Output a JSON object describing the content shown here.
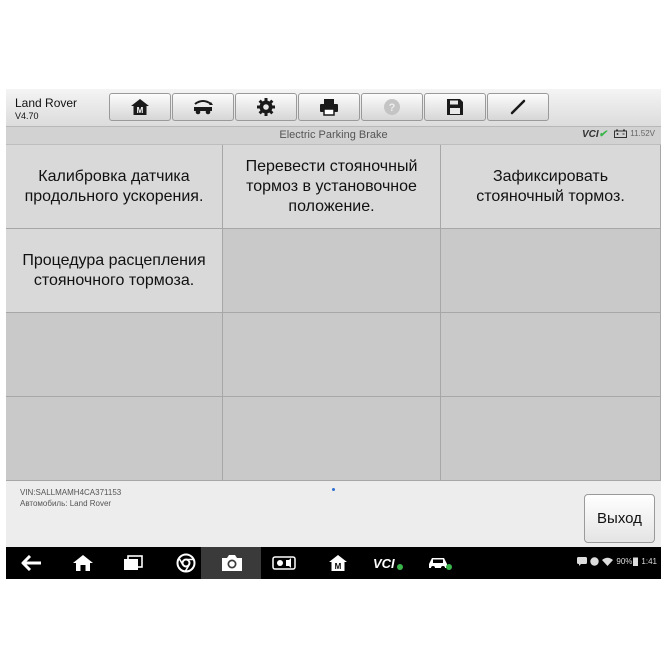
{
  "app": {
    "brand": "Land Rover",
    "version": "V4.70"
  },
  "toolbar": [
    {
      "name": "home-button",
      "icon": "home-icon"
    },
    {
      "name": "vehicle-swap-button",
      "icon": "vehicle-swap-icon"
    },
    {
      "name": "settings-button",
      "icon": "gear-icon"
    },
    {
      "name": "print-button",
      "icon": "printer-icon"
    },
    {
      "name": "help-button",
      "icon": "help-icon",
      "disabled": true
    },
    {
      "name": "save-button",
      "icon": "save-icon"
    },
    {
      "name": "edit-button",
      "icon": "pencil-icon"
    }
  ],
  "titlebar": {
    "title": "Electric Parking Brake",
    "vci_label": "VCI",
    "voltage": "11.52V"
  },
  "functions": [
    "Калибровка датчика продольного ускорения.",
    "Перевести стояночный тормоз в установочное положение.",
    "Зафиксировать стояночный тормоз.",
    "Процедура расцепления стояночного тормоза."
  ],
  "footer": {
    "vin": "VIN:SALLMAMH4CA371153",
    "vehicle": "Автомобиль: Land Rover",
    "exit_label": "Выход"
  },
  "statusbar": {
    "battery": "90%",
    "time": "1:41"
  },
  "colors": {
    "vci_connected": "#3ab54a",
    "page_indicator": "#2f6fd1"
  }
}
